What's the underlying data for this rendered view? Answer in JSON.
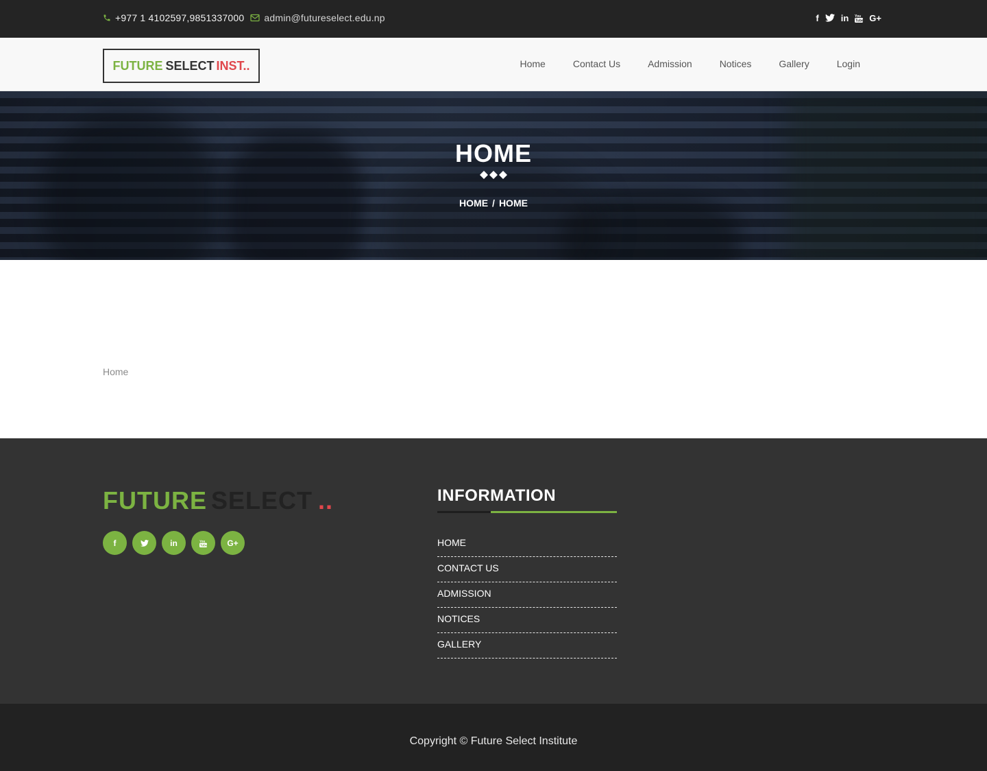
{
  "topbar": {
    "phone": "+977 1 4102597,9851337000",
    "email": "admin@futureselect.edu.np",
    "social_icons": [
      "facebook-icon",
      "twitter-icon",
      "linkedin-icon",
      "youtube-icon",
      "google-plus-icon"
    ]
  },
  "logo": {
    "part1": "FUTURE",
    "part2": "SELECT",
    "part3": "INST.."
  },
  "nav": {
    "items": [
      {
        "label": "Home"
      },
      {
        "label": "Contact Us"
      },
      {
        "label": "Admission"
      },
      {
        "label": "Notices"
      },
      {
        "label": "Gallery"
      },
      {
        "label": "Login"
      }
    ]
  },
  "hero": {
    "title": "HOME",
    "breadcrumb": [
      "HOME",
      "HOME"
    ],
    "separator": "/"
  },
  "content": {
    "text": "Home"
  },
  "footer": {
    "logo": {
      "part1": "FUTURE",
      "part2": "SELECT",
      "part3": ".."
    },
    "social_icons": [
      "facebook-icon",
      "twitter-icon",
      "linkedin-icon",
      "youtube-icon",
      "google-plus-icon"
    ],
    "info_title": "INFORMATION",
    "links": [
      {
        "label": "HOME"
      },
      {
        "label": "CONTACT US"
      },
      {
        "label": "ADMISSION"
      },
      {
        "label": "NOTICES"
      },
      {
        "label": "GALLERY"
      }
    ],
    "copyright": "Copyright © Future Select Institute"
  },
  "colors": {
    "accent": "#7cb342",
    "red": "#e0474c",
    "topbar": "#242424",
    "footer": "#333333",
    "copyright_bar": "#222222"
  }
}
